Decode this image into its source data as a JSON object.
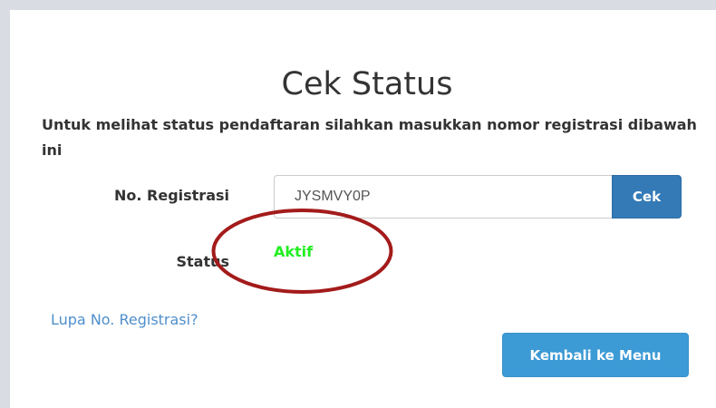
{
  "page": {
    "title": "Cek Status",
    "intro": "Untuk melihat status pendaftaran silahkan masukkan nomor registrasi dibawah ini"
  },
  "form": {
    "registration_label": "No. Registrasi",
    "registration_value": "JYSMVY0P",
    "check_button_label": "Cek",
    "status_label": "Status",
    "status_value": "Aktif"
  },
  "links": {
    "forgot_registration": "Lupa No. Registrasi?"
  },
  "actions": {
    "back_to_menu_label": "Kembali ke Menu"
  },
  "colors": {
    "primary_button": "#337ab7",
    "secondary_button": "#3c9ad5",
    "status_active": "#22ee22",
    "link": "#4f8fcb",
    "annotation_circle": "#a31b1b"
  }
}
